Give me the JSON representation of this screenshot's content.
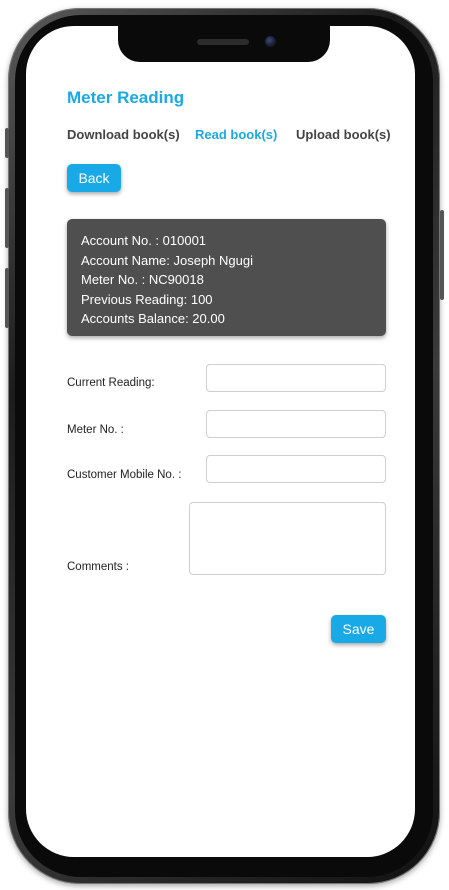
{
  "screen_title": "Meter Reading",
  "tabs": [
    {
      "label": "Download book(s)",
      "active": false
    },
    {
      "label": "Read book(s)",
      "active": true
    },
    {
      "label": "Upload book(s)",
      "active": false
    }
  ],
  "back_button": "Back",
  "account_info": {
    "account_no": "Account No. : 010001",
    "account_name": "Account Name: Joseph Ngugi",
    "meter_no": "Meter No. :  NC90018",
    "previous_reading": "Previous Reading: 100",
    "accounts_balance": "Accounts Balance: 20.00"
  },
  "form": {
    "current_reading": {
      "label": "Current Reading:",
      "value": ""
    },
    "meter_no": {
      "label": "Meter No. :",
      "value": ""
    },
    "customer_mobile": {
      "label": "Customer Mobile No. :",
      "value": ""
    },
    "comments": {
      "label": "Comments :",
      "value": ""
    }
  },
  "save_button": "Save",
  "colors": {
    "accent": "#1aaae3",
    "button": "#18a9e6",
    "card_background": "#4f4f4f",
    "phone_frame": "#1c1c1c"
  }
}
